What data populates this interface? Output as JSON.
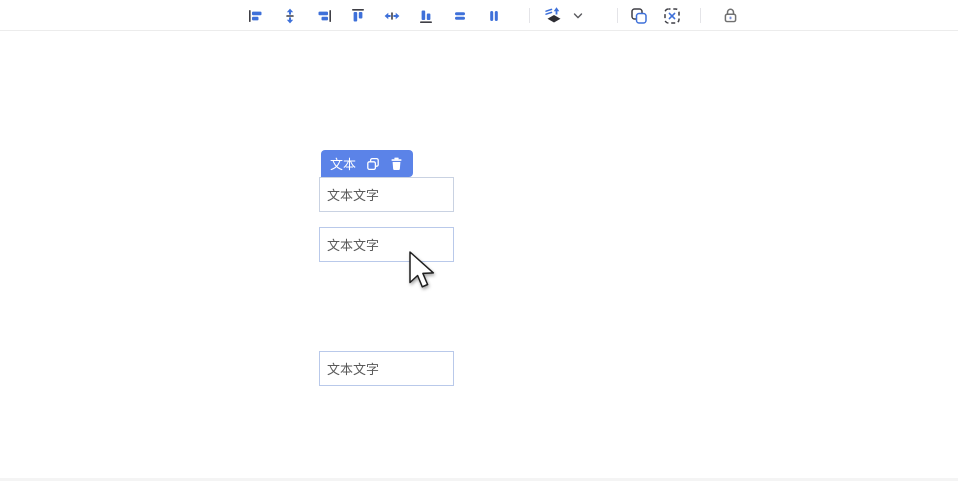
{
  "toolbar": {
    "icons": [
      {
        "name": "align-left-icon"
      },
      {
        "name": "align-vertical-center-icon"
      },
      {
        "name": "align-right-icon"
      },
      {
        "name": "align-top-icon"
      },
      {
        "name": "align-horizontal-center-icon"
      },
      {
        "name": "align-bottom-icon"
      },
      {
        "name": "distribute-vertical-icon"
      },
      {
        "name": "distribute-horizontal-icon"
      },
      {
        "name": "layer-order-icon"
      },
      {
        "name": "chevron-down-icon"
      },
      {
        "name": "duplicate-icon"
      },
      {
        "name": "remove-duplicate-icon"
      },
      {
        "name": "lock-icon"
      }
    ]
  },
  "canvas": {
    "selection_badge": {
      "label": "文本",
      "icons": [
        {
          "name": "copy-icon"
        },
        {
          "name": "trash-icon"
        }
      ]
    },
    "boxes": [
      {
        "text": "文本文字"
      },
      {
        "text": "文本文字"
      },
      {
        "text": "文本文字"
      }
    ]
  },
  "colors": {
    "icon_blue": "#3e70d9",
    "icon_dark": "#3f3f46",
    "badge_blue": "#5b83e8",
    "box_border_blue": "#b9c9ea",
    "box_border_gray": "#c9d2e2",
    "box_text": "#595959",
    "toolbar_border": "#ececec",
    "lock_gray": "#707070"
  }
}
